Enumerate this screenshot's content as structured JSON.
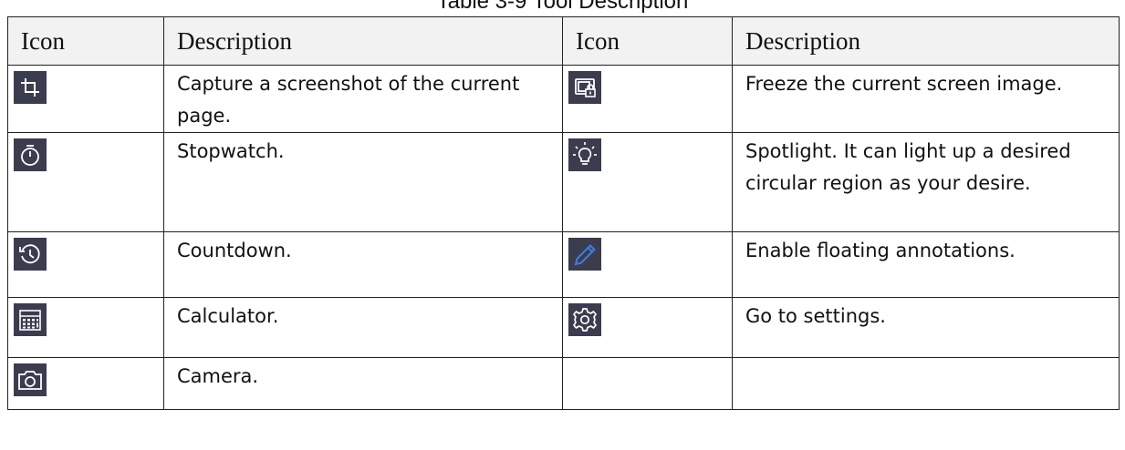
{
  "table": {
    "caption": "Table 3-9 Tool Description",
    "headers": [
      "Icon",
      "Description",
      "Icon",
      "Description"
    ],
    "rows": [
      {
        "left": {
          "icon": "crop-icon",
          "description": "Capture a screenshot of the current page."
        },
        "right": {
          "icon": "freeze-screen-icon",
          "description": "Freeze the current screen image."
        }
      },
      {
        "left": {
          "icon": "stopwatch-icon",
          "description": "Stopwatch."
        },
        "right": {
          "icon": "spotlight-icon",
          "description": "Spotlight. It can light up a desired circular region as your desire."
        }
      },
      {
        "left": {
          "icon": "countdown-icon",
          "description": "Countdown."
        },
        "right": {
          "icon": "pencil-icon",
          "description": "Enable floating annotations."
        }
      },
      {
        "left": {
          "icon": "calculator-icon",
          "description": "Calculator."
        },
        "right": {
          "icon": "settings-gear-icon",
          "description": "Go to settings."
        }
      },
      {
        "left": {
          "icon": "camera-icon",
          "description": "Camera."
        },
        "right": null
      }
    ]
  },
  "colors": {
    "icon_tile_background": "#3b3c4e",
    "icon_glyph": "#ffffff",
    "pencil_accent": "#3d7fe0",
    "header_background": "#f2f2f2",
    "border": "#222222"
  }
}
